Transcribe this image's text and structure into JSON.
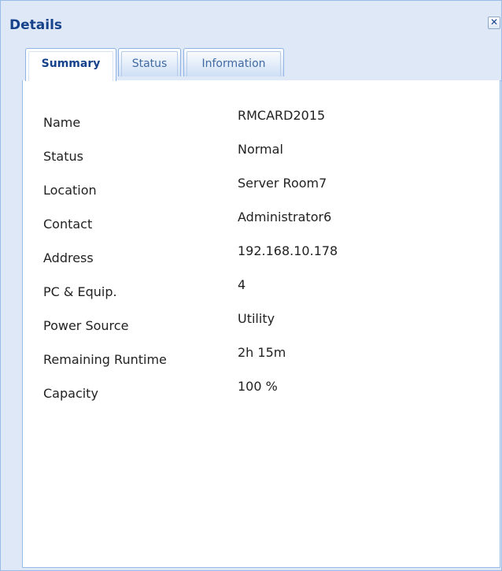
{
  "panel": {
    "title": "Details",
    "close_glyph": "✕"
  },
  "tabs": [
    {
      "label": "Summary",
      "active": true
    },
    {
      "label": "Status",
      "active": false
    },
    {
      "label": "Information",
      "active": false
    }
  ],
  "summary": {
    "rows": [
      {
        "label": "Name",
        "value": "RMCARD2015"
      },
      {
        "label": "Status",
        "value": "Normal"
      },
      {
        "label": "Location",
        "value": "Server Room7"
      },
      {
        "label": "Contact",
        "value": "Administrator6"
      },
      {
        "label": "Address",
        "value": "192.168.10.178"
      },
      {
        "label": "PC & Equip.",
        "value": "4"
      },
      {
        "label": "Power Source",
        "value": "Utility"
      },
      {
        "label": "Remaining Runtime",
        "value": "2h 15m"
      },
      {
        "label": "Capacity",
        "value": "100 %"
      }
    ]
  },
  "colors": {
    "title_text": "#15428b",
    "panel_background": "#dfe8f6",
    "border": "#99bbe8"
  }
}
